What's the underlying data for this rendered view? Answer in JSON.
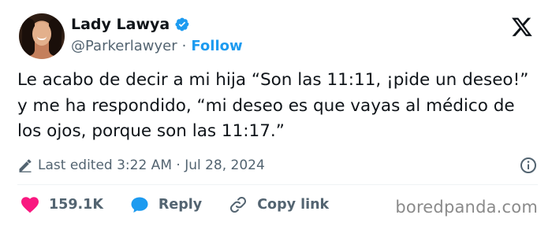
{
  "author": {
    "display_name": "Lady Lawya",
    "handle": "@Parkerlawyer",
    "separator": "·",
    "follow_label": "Follow",
    "verified": true
  },
  "platform_icon": "x-logo-icon",
  "tweet": {
    "text": "Le acabo de decir a mi hija “Son las 11:11, ¡pide un deseo!” y me ha respondido, “mi deseo es que vayas al médico de los ojos, porque son las 11:17.”",
    "meta": "Last edited 3:22 AM · Jul 28, 2024"
  },
  "actions": {
    "likes": "159.1K",
    "reply_label": "Reply",
    "copy_link_label": "Copy link"
  },
  "watermark": "boredpanda.com",
  "colors": {
    "accent": "#1d9bf0",
    "like": "#f91880",
    "text": "#0f1419",
    "secondary": "#536471"
  }
}
